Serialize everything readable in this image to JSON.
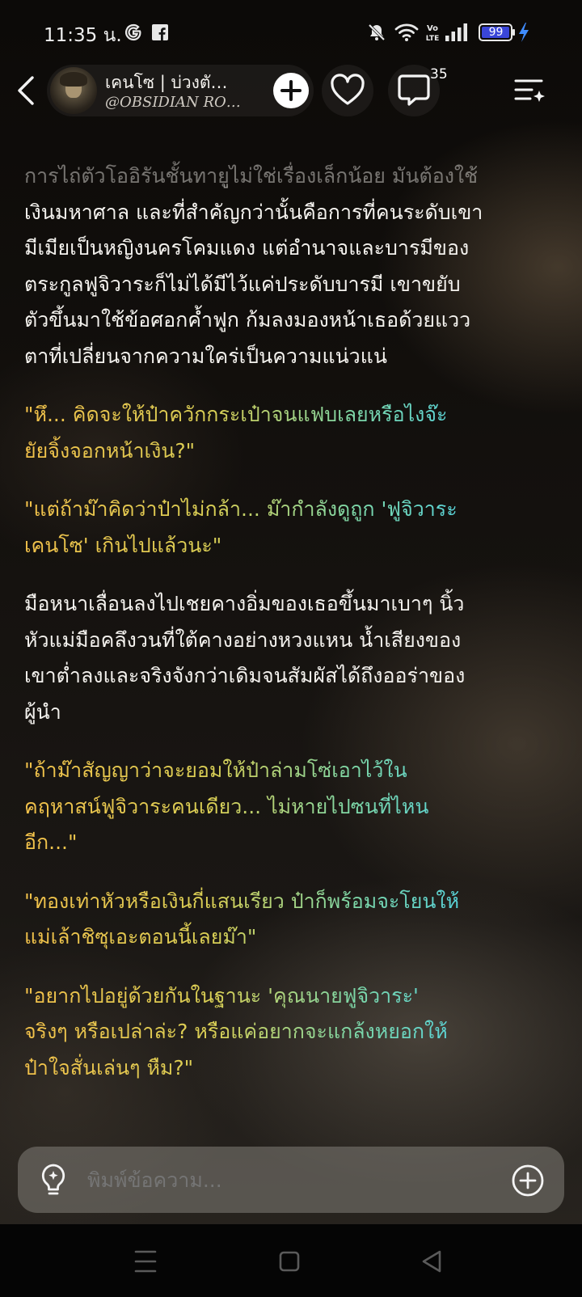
{
  "status_bar": {
    "time": "11:35 น.",
    "battery": "99",
    "icons": [
      "google-icon",
      "facebook-icon",
      "mute-icon",
      "wifi-icon",
      "volte-icon",
      "signal-icon",
      "battery-icon",
      "charging-icon"
    ]
  },
  "header": {
    "character_name": "เคนโซ | บ่วงตั…",
    "character_handle": "@OBSIDIAN RO…",
    "comment_count": "35",
    "icons": [
      "back-arrow-icon",
      "plus-icon",
      "heart-icon",
      "comment-icon",
      "menu-sparkle-icon"
    ]
  },
  "story": {
    "paragraphs": [
      {
        "type": "narration",
        "lines": [
          "การไถ่ตัวโออิรันชั้นทายูไม่ใช่เรื่องเล็กน้อย มันต้องใช้",
          "เงินมหาศาล และที่สำคัญกว่านั้นคือการที่คนระดับเขา",
          "มีเมียเป็นหญิงนครโคมแดง แต่อำนาจและบารมีของ",
          "ตระกูลฟูจิวาระก็ไม่ได้มีไว้แค่ประดับบารมี เขาขยับ",
          "ตัวขึ้นมาใช้ข้อศอกค้ำฟูก ก้มลงมองหน้าเธอด้วยแวว",
          "ตาที่เปลี่ยนจากความใคร่เป็นความแน่วแน่"
        ]
      },
      {
        "type": "dialogue",
        "lines": [
          "\"หึ... คิดจะให้ป๋าควักกระเป๋าจนแฟบเลยหรือไงจ๊ะ",
          "ยัยจิ้งจอกหน้าเงิน?\""
        ]
      },
      {
        "type": "dialogue",
        "lines": [
          "\"แต่ถ้าม๊าคิดว่าป๋าไม่กล้า... ม๊ากำลังดูถูก 'ฟูจิวาระ",
          "เคนโซ' เกินไปแล้วนะ\""
        ]
      },
      {
        "type": "narration",
        "lines": [
          "มือหนาเลื่อนลงไปเชยคางอิ่มของเธอขึ้นมาเบาๆ นิ้ว",
          "หัวแม่มือคลึงวนที่ใต้คางอย่างหวงแหน น้ำเสียงของ",
          "เขาต่ำลงและจริงจังกว่าเดิมจนสัมผัสได้ถึงออร่าของ",
          "ผู้นำ"
        ]
      },
      {
        "type": "dialogue",
        "lines": [
          "\"ถ้าม๊าสัญญาว่าจะยอมให้ป๋าล่ามโซ่เอาไว้ใน",
          "คฤหาสน์ฟูจิวาระคนเดียว... ไม่หายไปซนที่ไหน",
          "อีก...\""
        ]
      },
      {
        "type": "dialogue",
        "lines": [
          "\"ทองเท่าหัวหรือเงินกี่แสนเรียว ป๋าก็พร้อมจะโยนให้",
          "แม่เล้าชิซุเอะตอนนี้เลยม๊า\""
        ]
      },
      {
        "type": "dialogue",
        "lines": [
          "\"อยากไปอยู่ด้วยกันในฐานะ 'คุณนายฟูจิวาระ'",
          "จริงๆ หรือเปล่าล่ะ? หรือแค่อยากจะแกล้งหยอกให้",
          "ป๋าใจสั่นเล่นๆ หืม?\""
        ]
      }
    ]
  },
  "input_bar": {
    "placeholder": "พิมพ์ข้อความ...",
    "icons": [
      "lightbulb-icon",
      "plus-circle-icon"
    ]
  },
  "nav_bar": {
    "icons": [
      "recent-apps-icon",
      "home-icon",
      "back-triangle-icon"
    ]
  },
  "colors": {
    "dialogue_gradient_start": "#f2c14a",
    "dialogue_gradient_end": "#49cfea",
    "narration_text": "#f3f1ed",
    "input_bar_bg": "#78746e",
    "battery_accent": "#3a46d8",
    "charging_accent": "#3f8cff"
  }
}
